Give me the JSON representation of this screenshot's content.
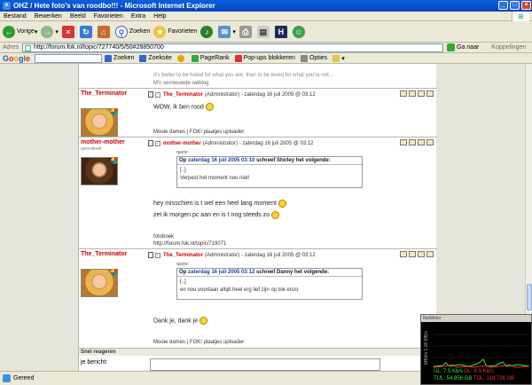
{
  "window": {
    "title": "OHZ / Hete foto's van roodbo!!! - Microsoft Internet Explorer"
  },
  "menu": [
    "Bestand",
    "Bewerken",
    "Beeld",
    "Favorieten",
    "Extra",
    "Help"
  ],
  "toolbar": {
    "back": "Vorige",
    "search": "Zoeken",
    "favorites": "Favorieten"
  },
  "address": {
    "label": "Adres",
    "url": "http://forum.fok.nl/topic/727740/5/50#28850700",
    "go": "Ga naar",
    "links": "Koppelingen"
  },
  "googlebar": {
    "search": "Zoeken",
    "site": "Zoeksite",
    "pagerank": "PageRank",
    "popups": "Pop-ups blokkeren",
    "options": "Opties"
  },
  "top_sig": {
    "quote": "It's better to be hated for what you are, than to be loved for what you're not...",
    "link": "M'n vernieuwde weblog"
  },
  "posts": [
    {
      "user": "The_Terminator",
      "role": "",
      "header_name": "The_Terminator",
      "header_meta": "(Administrator) - zaterdag 16 juli 2005 @ 03:12",
      "text": "WOW, ik ben rood",
      "footer": "Mooie dames | FOK! plaatjes uploader"
    },
    {
      "user": "mother-mother",
      "role": "gers+bnek",
      "header_name": "mother-mother",
      "header_meta": "(Administrator) - zaterdag 16 juli 2005 @ 03:12",
      "quote_label": "quote:",
      "quote_head_pre": "Op ",
      "quote_head_date": "zaterdag 16 juli 2005 03:10",
      "quote_head_post": " schreef Shirley het volgende:",
      "quote_lines": [
        "[..]",
        "Verpest het moment nou niet!"
      ],
      "text_lines": [
        "hey misschien is t wel een heel lang moment",
        "zet ik morgen pc aan en is t nog steeds zo"
      ],
      "footer_lines": [
        "fotoboek",
        "http://forum.fok.nl/topic/719071"
      ]
    },
    {
      "user": "The_Terminator",
      "role": "",
      "header_name": "The_Terminator",
      "header_meta": "(Administrator) - zaterdag 16 juli 2005 @ 03:12",
      "quote_label": "quote:",
      "quote_head_pre": "Op ",
      "quote_head_date": "zaterdag 16 juli 2005 03:12",
      "quote_head_post": " schreef Danny het volgende:",
      "quote_lines": [
        "[..]",
        "en nou voortaan altijd heel erg lief zijn op tok enzo"
      ],
      "text": "Dank je, dank je",
      "footer": "Mooie dames | FOK! plaatjes uploader"
    }
  ],
  "reply": {
    "header": "Snel reageren",
    "label": "je bericht:"
  },
  "status": {
    "text": "Gereed"
  },
  "netmeter": {
    "title": "NetMeter",
    "side": "MBit/s 1.08 MB/s",
    "ul": "UL: 7.5 Kb/s",
    "dl": "DL: 6.9 Kb/s",
    "tul": "TUL: 54.856 GB",
    "tdl": "TDL: 118.736 GB"
  },
  "colors": {
    "accent": "#0a5fe0",
    "username": "#cc0000",
    "date": "#1a3ea8"
  },
  "icons": [
    "ie-icon",
    "back-icon",
    "forward-icon",
    "stop-icon",
    "refresh-icon",
    "home-icon",
    "search-icon",
    "favorites-icon",
    "media-icon",
    "mail-icon",
    "print-icon",
    "edit-icon",
    "messenger-icon",
    "go-icon"
  ]
}
